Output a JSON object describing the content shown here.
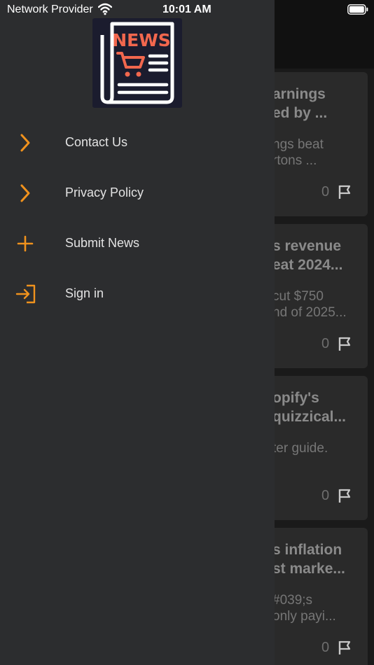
{
  "status_bar": {
    "provider": "Network Provider",
    "time": "10:01 AM"
  },
  "drawer": {
    "logo_text": "NEWS",
    "menu": [
      {
        "label": "Contact Us",
        "icon": "chevron-right-icon"
      },
      {
        "label": "Privacy Policy",
        "icon": "chevron-right-icon"
      },
      {
        "label": "Submit News",
        "icon": "plus-icon"
      },
      {
        "label": "Sign in",
        "icon": "sign-in-icon"
      }
    ]
  },
  "background_cards": [
    {
      "title": "arnings\ned by ...",
      "desc": "ngs beat\nrtons ...",
      "count": "0"
    },
    {
      "title": "s revenue\neat 2024...",
      "desc": "cut $750\nnd of 2025...",
      "count": "0"
    },
    {
      "title": "opify's\nquizzical...",
      "desc": "ter guide.",
      "count": "0"
    },
    {
      "title": "s inflation\nst marke...",
      "desc": "#039;s\nonly payi...",
      "count": "0"
    }
  ],
  "colors": {
    "accent": "#f0921d",
    "drawer_bg": "#2c2d2f",
    "logo_bg": "#1b1c2e",
    "logo_red": "#f2674e"
  }
}
